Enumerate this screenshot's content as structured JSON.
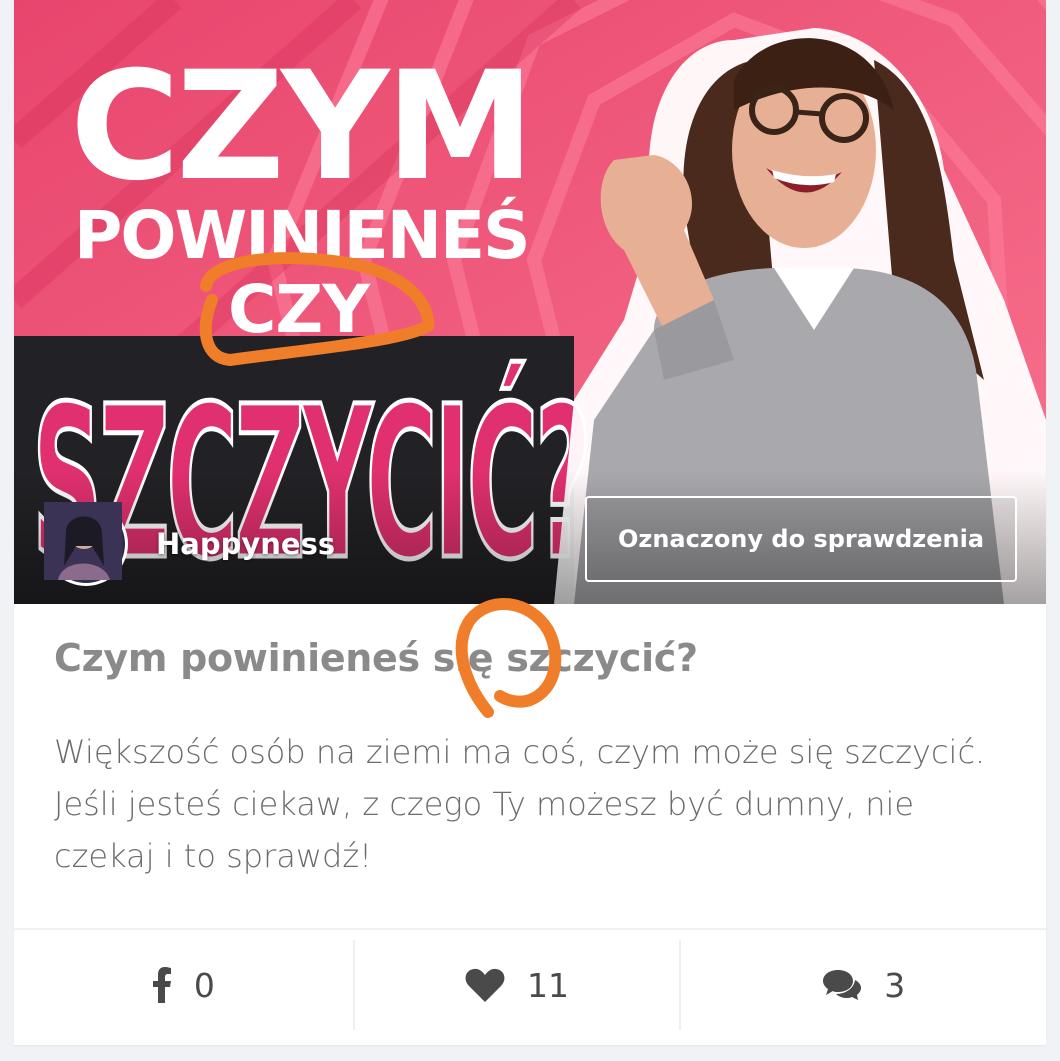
{
  "card": {
    "hero": {
      "headline_top": "CZYM",
      "headline_mid": "POWINIENEŚ",
      "headline_small": "CZY",
      "headline_big": "SZCZYCIĆ?",
      "author_name": "Happyness",
      "avatar_icon": "user-avatar-icon",
      "flag_label": "Oznaczony do sprawdzenia"
    },
    "title": "Czym powinieneś się szczycić?",
    "description": "Większość osób na ziemi ma coś, czym może się szczycić. Jeśli jesteś ciekaw, z czego Ty możesz być dumny, nie czekaj i to sprawdź!",
    "actions": {
      "facebook": {
        "icon": "facebook-icon",
        "count": "0"
      },
      "likes": {
        "icon": "heart-icon",
        "count": "11"
      },
      "comments": {
        "icon": "comments-icon",
        "count": "3"
      }
    }
  },
  "colors": {
    "hero_pink": "#f05a7e",
    "headline_magenta": "#e0306f",
    "annotation_orange": "#f07d2a",
    "title_gray": "#8a8a8a",
    "text_gray": "#6b6b6b"
  }
}
